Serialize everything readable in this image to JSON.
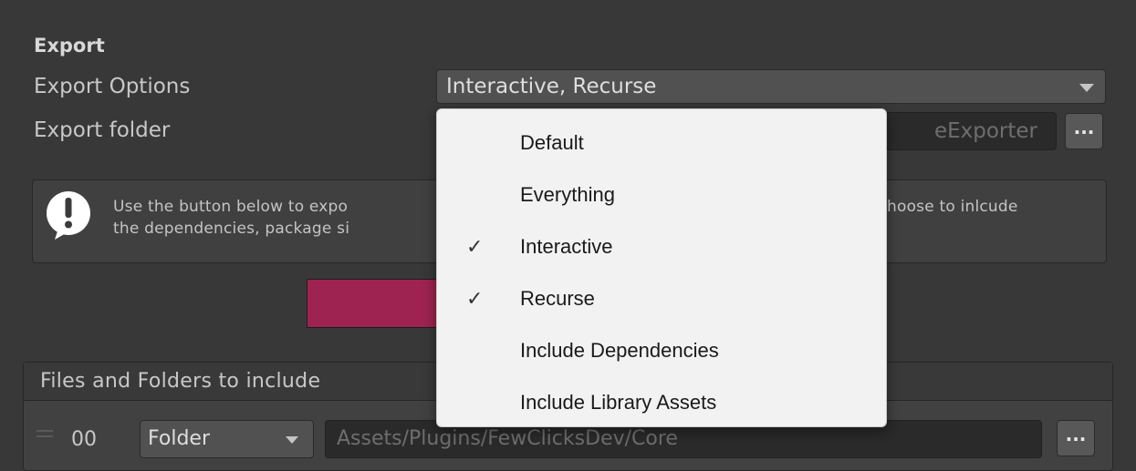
{
  "export": {
    "section_title": "Export",
    "options_label": "Export Options",
    "options_value": "Interactive, Recurse",
    "folder_label": "Export folder",
    "folder_value": "eExporter",
    "browse_label": "..."
  },
  "help": {
    "line1": "Use the button below to expo",
    "line1_end": "hoose to inlcude",
    "line2": "the dependencies, package si"
  },
  "files": {
    "header": "Files and Folders to include",
    "rows": [
      {
        "index": "00",
        "type": "Folder",
        "path": "Assets/Plugins/FewClicksDev/Core",
        "browse_label": "..."
      }
    ]
  },
  "dropdown_menu": {
    "items": [
      {
        "label": "Default",
        "checked": false
      },
      {
        "label": "Everything",
        "checked": false
      },
      {
        "label": "Interactive",
        "checked": true
      },
      {
        "label": "Recurse",
        "checked": true
      },
      {
        "label": "Include Dependencies",
        "checked": false
      },
      {
        "label": "Include Library Assets",
        "checked": false
      }
    ],
    "check_glyph": "✓"
  },
  "colors": {
    "background": "#383838",
    "export_button": "#9e2350",
    "menu_background": "#f2f2f2"
  }
}
